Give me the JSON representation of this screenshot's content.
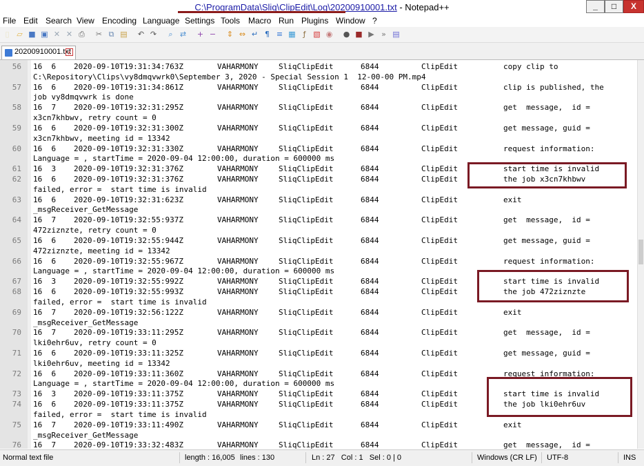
{
  "window": {
    "title_path": "C:\\ProgramData\\Sliq\\ClipEdit\\Log\\20200910001.txt",
    "title_suffix": " - Notepad++",
    "btn_min": "_",
    "btn_max": "□",
    "btn_close": "X"
  },
  "menu": [
    "File",
    "Edit",
    "Search",
    "View",
    "Encoding",
    "Language",
    "Settings",
    "Tools",
    "Macro",
    "Run",
    "Plugins",
    "Window",
    "?"
  ],
  "toolbar_icons": [
    "new-file-icon",
    "open-file-icon",
    "save-icon",
    "save-all-icon",
    "close-icon",
    "close-all-icon",
    "print-icon",
    "cut-icon",
    "copy-icon",
    "paste-icon",
    "undo-icon",
    "redo-icon",
    "find-icon",
    "replace-icon",
    "zoom-in-icon",
    "zoom-out-icon",
    "sync-vertical-icon",
    "sync-horizontal-icon",
    "word-wrap-icon",
    "show-all-chars-icon",
    "indent-guide-icon",
    "doc-map-icon",
    "function-list-icon",
    "folder-workspace-icon",
    "monitor-icon",
    "record-macro-icon",
    "stop-macro-icon",
    "play-macro-icon",
    "run-macro-multiple-icon",
    "save-macro-icon"
  ],
  "tab": {
    "label": "20200910001.txt",
    "close": "x"
  },
  "lines": [
    {
      "n": "56",
      "c": [
        "16  6",
        "2020-09-10T19:31:34:763Z",
        "VAHARMONY",
        "SliqClipEdit",
        "6844",
        "ClipEdit",
        "copy clip to"
      ]
    },
    {
      "n": "",
      "w": "C:\\Repository\\Clips\\vy8dmqvwrk0\\September 3, 2020 - Special Session 1  12-00-00 PM.mp4"
    },
    {
      "n": "57",
      "c": [
        "16  6",
        "2020-09-10T19:31:34:861Z",
        "VAHARMONY",
        "SliqClipEdit",
        "6844",
        "ClipEdit",
        "clip is published, the"
      ]
    },
    {
      "n": "",
      "w": "job vy8dmqvwrk is done"
    },
    {
      "n": "58",
      "c": [
        "16  7",
        "2020-09-10T19:32:31:295Z",
        "VAHARMONY",
        "SliqClipEdit",
        "6844",
        "ClipEdit",
        "get  message,  id ="
      ]
    },
    {
      "n": "",
      "w": "x3cn7khbwv, retry count = 0"
    },
    {
      "n": "59",
      "c": [
        "16  6",
        "2020-09-10T19:32:31:300Z",
        "VAHARMONY",
        "SliqClipEdit",
        "6844",
        "ClipEdit",
        "get message, guid ="
      ]
    },
    {
      "n": "",
      "w": "x3cn7khbwv, meeting id = 13342"
    },
    {
      "n": "60",
      "c": [
        "16  6",
        "2020-09-10T19:32:31:330Z",
        "VAHARMONY",
        "SliqClipEdit",
        "6844",
        "ClipEdit",
        "request information:"
      ]
    },
    {
      "n": "",
      "w": "Language = , startTime = 2020-09-04 12:00:00, duration = 600000 ms"
    },
    {
      "n": "61",
      "c": [
        "16  3",
        "2020-09-10T19:32:31:376Z",
        "VAHARMONY",
        "SliqClipEdit",
        "6844",
        "ClipEdit",
        "start time is invalid"
      ]
    },
    {
      "n": "62",
      "c": [
        "16  6",
        "2020-09-10T19:32:31:376Z",
        "VAHARMONY",
        "SliqClipEdit",
        "6844",
        "ClipEdit",
        "the job x3cn7khbwv"
      ]
    },
    {
      "n": "",
      "w": "failed, error =  start time is invalid"
    },
    {
      "n": "63",
      "c": [
        "16  6",
        "2020-09-10T19:32:31:623Z",
        "VAHARMONY",
        "SliqClipEdit",
        "6844",
        "ClipEdit",
        "exit"
      ]
    },
    {
      "n": "",
      "w": "_msgReceiver_GetMessage"
    },
    {
      "n": "64",
      "c": [
        "16  7",
        "2020-09-10T19:32:55:937Z",
        "VAHARMONY",
        "SliqClipEdit",
        "6844",
        "ClipEdit",
        "get  message,  id ="
      ]
    },
    {
      "n": "",
      "w": "472ziznzte, retry count = 0"
    },
    {
      "n": "65",
      "c": [
        "16  6",
        "2020-09-10T19:32:55:944Z",
        "VAHARMONY",
        "SliqClipEdit",
        "6844",
        "ClipEdit",
        "get message, guid ="
      ]
    },
    {
      "n": "",
      "w": "472ziznzte, meeting id = 13342"
    },
    {
      "n": "66",
      "c": [
        "16  6",
        "2020-09-10T19:32:55:967Z",
        "VAHARMONY",
        "SliqClipEdit",
        "6844",
        "ClipEdit",
        "request information:"
      ]
    },
    {
      "n": "",
      "w": "Language = , startTime = 2020-09-04 12:00:00, duration = 600000 ms"
    },
    {
      "n": "67",
      "c": [
        "16  3",
        "2020-09-10T19:32:55:992Z",
        "VAHARMONY",
        "SliqClipEdit",
        "6844",
        "ClipEdit",
        "start time is invalid"
      ]
    },
    {
      "n": "68",
      "c": [
        "16  6",
        "2020-09-10T19:32:55:993Z",
        "VAHARMONY",
        "SliqClipEdit",
        "6844",
        "ClipEdit",
        "the job 472ziznzte"
      ]
    },
    {
      "n": "",
      "w": "failed, error =  start time is invalid"
    },
    {
      "n": "69",
      "c": [
        "16  7",
        "2020-09-10T19:32:56:122Z",
        "VAHARMONY",
        "SliqClipEdit",
        "6844",
        "ClipEdit",
        "exit"
      ]
    },
    {
      "n": "",
      "w": "_msgReceiver_GetMessage"
    },
    {
      "n": "70",
      "c": [
        "16  7",
        "2020-09-10T19:33:11:295Z",
        "VAHARMONY",
        "SliqClipEdit",
        "6844",
        "ClipEdit",
        "get  message,  id ="
      ]
    },
    {
      "n": "",
      "w": "lki0ehr6uv, retry count = 0"
    },
    {
      "n": "71",
      "c": [
        "16  6",
        "2020-09-10T19:33:11:325Z",
        "VAHARMONY",
        "SliqClipEdit",
        "6844",
        "ClipEdit",
        "get message, guid ="
      ]
    },
    {
      "n": "",
      "w": "lki0ehr6uv, meeting id = 13342"
    },
    {
      "n": "72",
      "c": [
        "16  6",
        "2020-09-10T19:33:11:360Z",
        "VAHARMONY",
        "SliqClipEdit",
        "6844",
        "ClipEdit",
        "request information:"
      ]
    },
    {
      "n": "",
      "w": "Language = , startTime = 2020-09-04 12:00:00, duration = 600000 ms"
    },
    {
      "n": "73",
      "c": [
        "16  3",
        "2020-09-10T19:33:11:375Z",
        "VAHARMONY",
        "SliqClipEdit",
        "6844",
        "ClipEdit",
        "start time is invalid"
      ]
    },
    {
      "n": "74",
      "c": [
        "16  6",
        "2020-09-10T19:33:11:375Z",
        "VAHARMONY",
        "SliqClipEdit",
        "6844",
        "ClipEdit",
        "the job lki0ehr6uv"
      ]
    },
    {
      "n": "",
      "w": "failed, error =  start time is invalid"
    },
    {
      "n": "75",
      "c": [
        "16  7",
        "2020-09-10T19:33:11:490Z",
        "VAHARMONY",
        "SliqClipEdit",
        "6844",
        "ClipEdit",
        "exit"
      ]
    },
    {
      "n": "",
      "w": "_msgReceiver_GetMessage"
    },
    {
      "n": "76",
      "c": [
        "16  7",
        "2020-09-10T19:33:32:483Z",
        "VAHARMONY",
        "SliqClipEdit",
        "6844",
        "ClipEdit",
        "get  message,  id ="
      ]
    }
  ],
  "status": {
    "type": "Normal text file",
    "length": "length : 16,005",
    "lines": "lines : 130",
    "position": "Ln : 27   Col : 1   Sel : 0 | 0",
    "eol": "Windows (CR LF)",
    "encoding": "UTF-8",
    "mode": "INS"
  },
  "colors": {
    "annotation": "#7a1a24",
    "title_underline": "#8b1a1a",
    "gutter": "#e4e4e4"
  }
}
